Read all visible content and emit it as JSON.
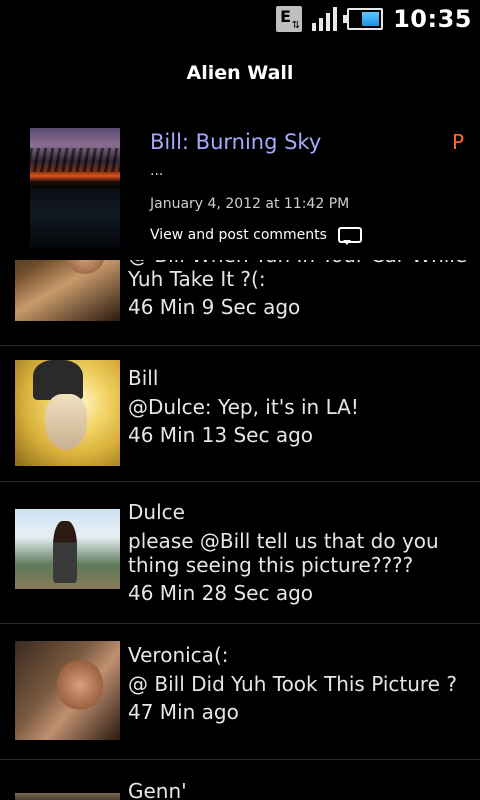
{
  "status_bar": {
    "network_badge": "E",
    "time": "10:35",
    "battery_level_percent": 60,
    "signal_bars": 4
  },
  "app": {
    "title": "Alien Wall"
  },
  "post": {
    "title": "Bill: Burning Sky",
    "flag": "P",
    "description": "...",
    "date": "January 4, 2012 at 11:42 PM",
    "comments_link": "View and post comments"
  },
  "comments": [
    {
      "name": "",
      "body": "@ Bill When Yuh In Your Car While Yuh Take It ?(:",
      "time": "46 Min 9 Sec ago"
    },
    {
      "name": "Bill",
      "body": "@Dulce: Yep, it's in LA!",
      "time": "46 Min 13 Sec ago"
    },
    {
      "name": "Dulce",
      "body": "please @Bill tell us that do you thing seeing this picture????",
      "time": "46 Min 28 Sec ago"
    },
    {
      "name": "Veronica(:",
      "body": "@ Bill Did Yuh Took This Picture ?",
      "time": "47 Min ago"
    },
    {
      "name": "Genn'",
      "body": "",
      "time": ""
    }
  ]
}
